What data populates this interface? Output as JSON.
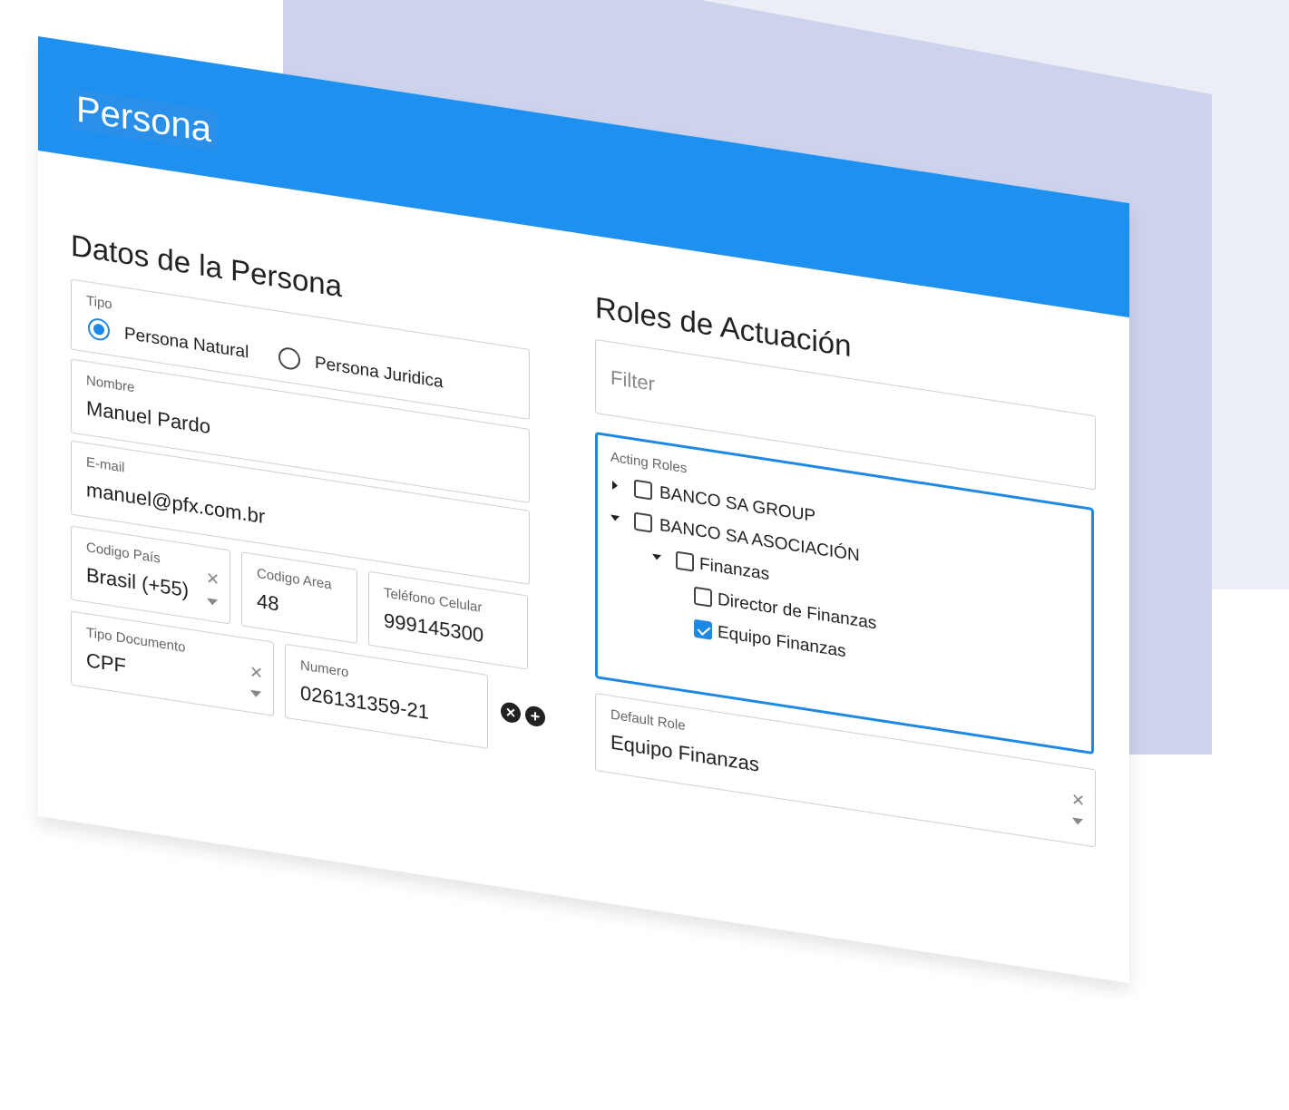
{
  "header": {
    "title": "Persona"
  },
  "persona": {
    "section_title": "Datos de la Persona",
    "tipo": {
      "label": "Tipo",
      "options": [
        "Persona Natural",
        "Persona Juridica"
      ],
      "selected": "Persona Natural"
    },
    "nombre": {
      "label": "Nombre",
      "value": "Manuel Pardo"
    },
    "email": {
      "label": "E-mail",
      "value": "manuel@pfx.com.br"
    },
    "codigo_pais": {
      "label": "Codigo País",
      "value": "Brasil (+55)"
    },
    "codigo_area": {
      "label": "Codigo Area",
      "value": "48"
    },
    "telefono": {
      "label": "Teléfono Celular",
      "value": "999145300"
    },
    "tipo_documento": {
      "label": "Tipo Documento",
      "value": "CPF"
    },
    "numero": {
      "label": "Numero",
      "value": "026131359-21"
    }
  },
  "roles": {
    "section_title": "Roles de Actuación",
    "filter_placeholder": "Filter",
    "acting_roles_label": "Acting Roles",
    "tree": [
      {
        "label": "BANCO SA GROUP",
        "checked": false,
        "expanded": false
      },
      {
        "label": "BANCO SA ASOCIACIÓN",
        "checked": false,
        "expanded": true
      },
      {
        "label": "Finanzas",
        "checked": false,
        "expanded": true
      },
      {
        "label": "Director de Finanzas",
        "checked": false
      },
      {
        "label": "Equipo Finanzas",
        "checked": true
      }
    ],
    "default_role": {
      "label": "Default Role",
      "value": "Equipo Finanzas"
    }
  },
  "colors": {
    "header": "#1e90f0",
    "accent": "#1e88e5",
    "bg_light": "#ebeef7",
    "bg_mid": "#cdd3ec"
  },
  "icons": [
    "remove-circle-icon",
    "add-circle-icon",
    "clear-icon",
    "dropdown-caret-icon"
  ]
}
